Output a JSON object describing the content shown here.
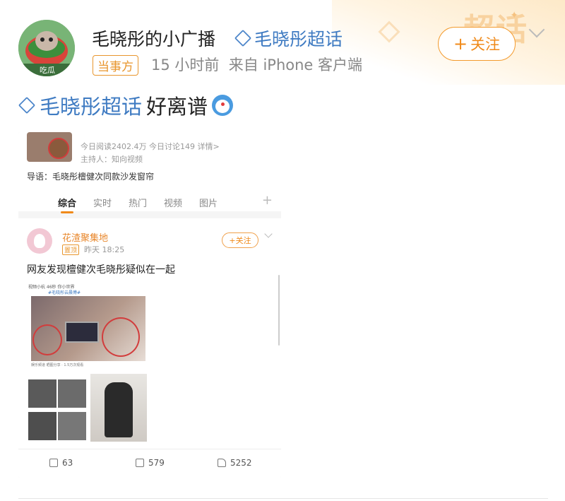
{
  "header": {
    "nickname": "毛晓彤的小广播",
    "topic": "毛晓彤超话",
    "badge": "当事方",
    "time": "15 小时前",
    "source": "来自 iPhone 客户端",
    "follow_label": "关注",
    "background_text": "超话",
    "avatar_label": "吃瓜"
  },
  "post": {
    "topic": "毛晓彤超话",
    "text": "好离谱"
  },
  "embedded": {
    "stats": "今日阅读2402.4万  今日讨论149  详情>",
    "host": "主持人：知向视频",
    "lead": "导语：毛晓彤檀健次同款沙发窗帘",
    "tabs": [
      "综合",
      "实时",
      "热门",
      "视频",
      "图片"
    ],
    "active_tab": "综合",
    "card": {
      "username": "花渣聚集地",
      "pin": "置顶",
      "time": "昨天 18:25",
      "follow_label": "+关注",
      "text": "网友发现檀健次毛晓彤疑似在一起",
      "inner_top": "视频小杭 46秒 你小世界",
      "inner_topic": "#毛晓彤云晨傅#",
      "photo_caption": "娱乐频道 晒图分享 · 1.5万次观看"
    },
    "actions": {
      "repost": "63",
      "comment": "579",
      "like": "5252"
    }
  },
  "colors": {
    "accent": "#f08a1a",
    "topic_blue": "#3f7bc2"
  }
}
